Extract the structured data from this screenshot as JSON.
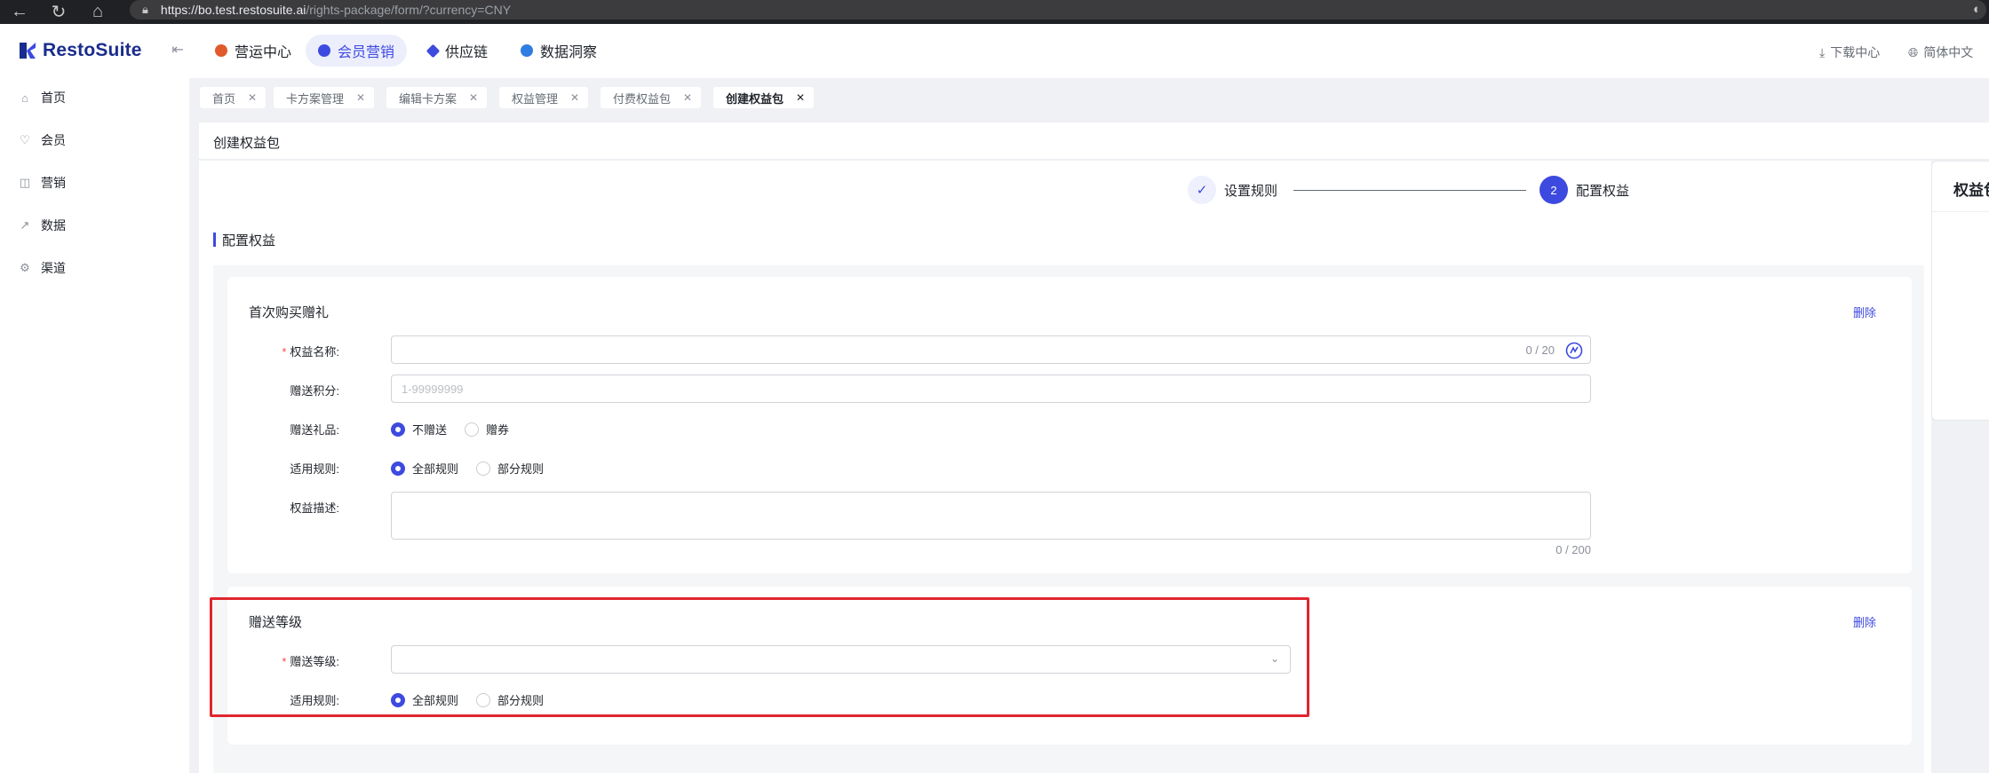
{
  "browser": {
    "url_host": "https://bo.test.restosuite.ai",
    "url_path": "/rights-package/form/?currency=CNY"
  },
  "app": {
    "logo_text": "RestoSuite"
  },
  "modules": [
    {
      "label": "营运中心",
      "icon": "operations-icon",
      "color": "#e05a2b"
    },
    {
      "label": "会员营销",
      "icon": "member-marketing-icon",
      "color": "#3d4ae0",
      "active": true
    },
    {
      "label": "供应链",
      "icon": "supply-chain-icon",
      "color": "#3d4ae0"
    },
    {
      "label": "数据洞察",
      "icon": "data-insight-icon",
      "color": "#2f7de1"
    }
  ],
  "topright": {
    "download_center": "下载中心",
    "language": "简体中文"
  },
  "sidebar": {
    "items": [
      {
        "label": "首页",
        "icon": "home-icon"
      },
      {
        "label": "会员",
        "icon": "member-icon"
      },
      {
        "label": "营销",
        "icon": "marketing-icon"
      },
      {
        "label": "数据",
        "icon": "chart-icon"
      },
      {
        "label": "渠道",
        "icon": "channel-icon"
      }
    ]
  },
  "tabs": [
    {
      "label": "首页"
    },
    {
      "label": "卡方案管理"
    },
    {
      "label": "编辑卡方案"
    },
    {
      "label": "权益管理"
    },
    {
      "label": "付费权益包"
    },
    {
      "label": "创建权益包",
      "active": true
    }
  ],
  "page": {
    "title": "创建权益包"
  },
  "steps": [
    {
      "label": "设置规则",
      "status": "done"
    },
    {
      "number": "2",
      "label": "配置权益",
      "status": "current"
    }
  ],
  "section": {
    "title": "配置权益"
  },
  "card1": {
    "title": "首次购买赠礼",
    "delete_label": "删除",
    "name_label": "权益名称:",
    "name_count": "0 / 20",
    "points_label": "赠送积分:",
    "points_placeholder": "1-99999999",
    "gift_label": "赠送礼品:",
    "gift_options": [
      "不赠送",
      "赠券"
    ],
    "rule_label": "适用规则:",
    "rule_options": [
      "全部规则",
      "部分规则"
    ],
    "desc_label": "权益描述:",
    "desc_count": "0 / 200"
  },
  "card2": {
    "title": "赠送等级",
    "delete_label": "删除",
    "level_label": "赠送等级:",
    "rule_label": "适用规则:",
    "rule_options": [
      "全部规则",
      "部分规则"
    ]
  },
  "right_panel": {
    "title": "权益包"
  },
  "colors": {
    "accent": "#3d4ae0",
    "highlight": "#e0252d",
    "required": "#f54a45"
  }
}
